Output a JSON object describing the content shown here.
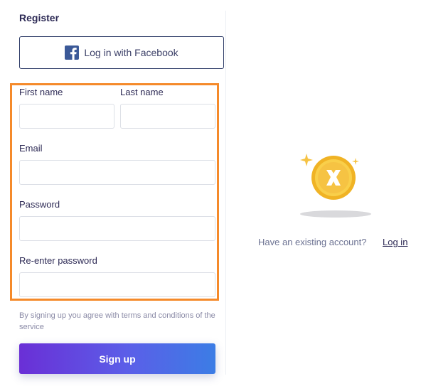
{
  "register": {
    "heading": "Register",
    "facebook_button": "Log in with Facebook",
    "first_name_label": "First name",
    "last_name_label": "Last name",
    "email_label": "Email",
    "password_label": "Password",
    "reenter_password_label": "Re-enter password",
    "first_name_value": "",
    "last_name_value": "",
    "email_value": "",
    "password_value": "",
    "reenter_password_value": "",
    "terms_text": "By signing up you agree with terms and conditions of the service",
    "signup_button": "Sign up"
  },
  "side": {
    "existing_account_text": "Have an existing account?",
    "login_link": "Log in",
    "illustration_icon": "coin-x-icon"
  },
  "colors": {
    "highlight": "#f58a2a",
    "facebook": "#3b5998",
    "button_gradient_start": "#6a2fd6",
    "button_gradient_end": "#3c7de5",
    "coin": "#f6c343"
  }
}
